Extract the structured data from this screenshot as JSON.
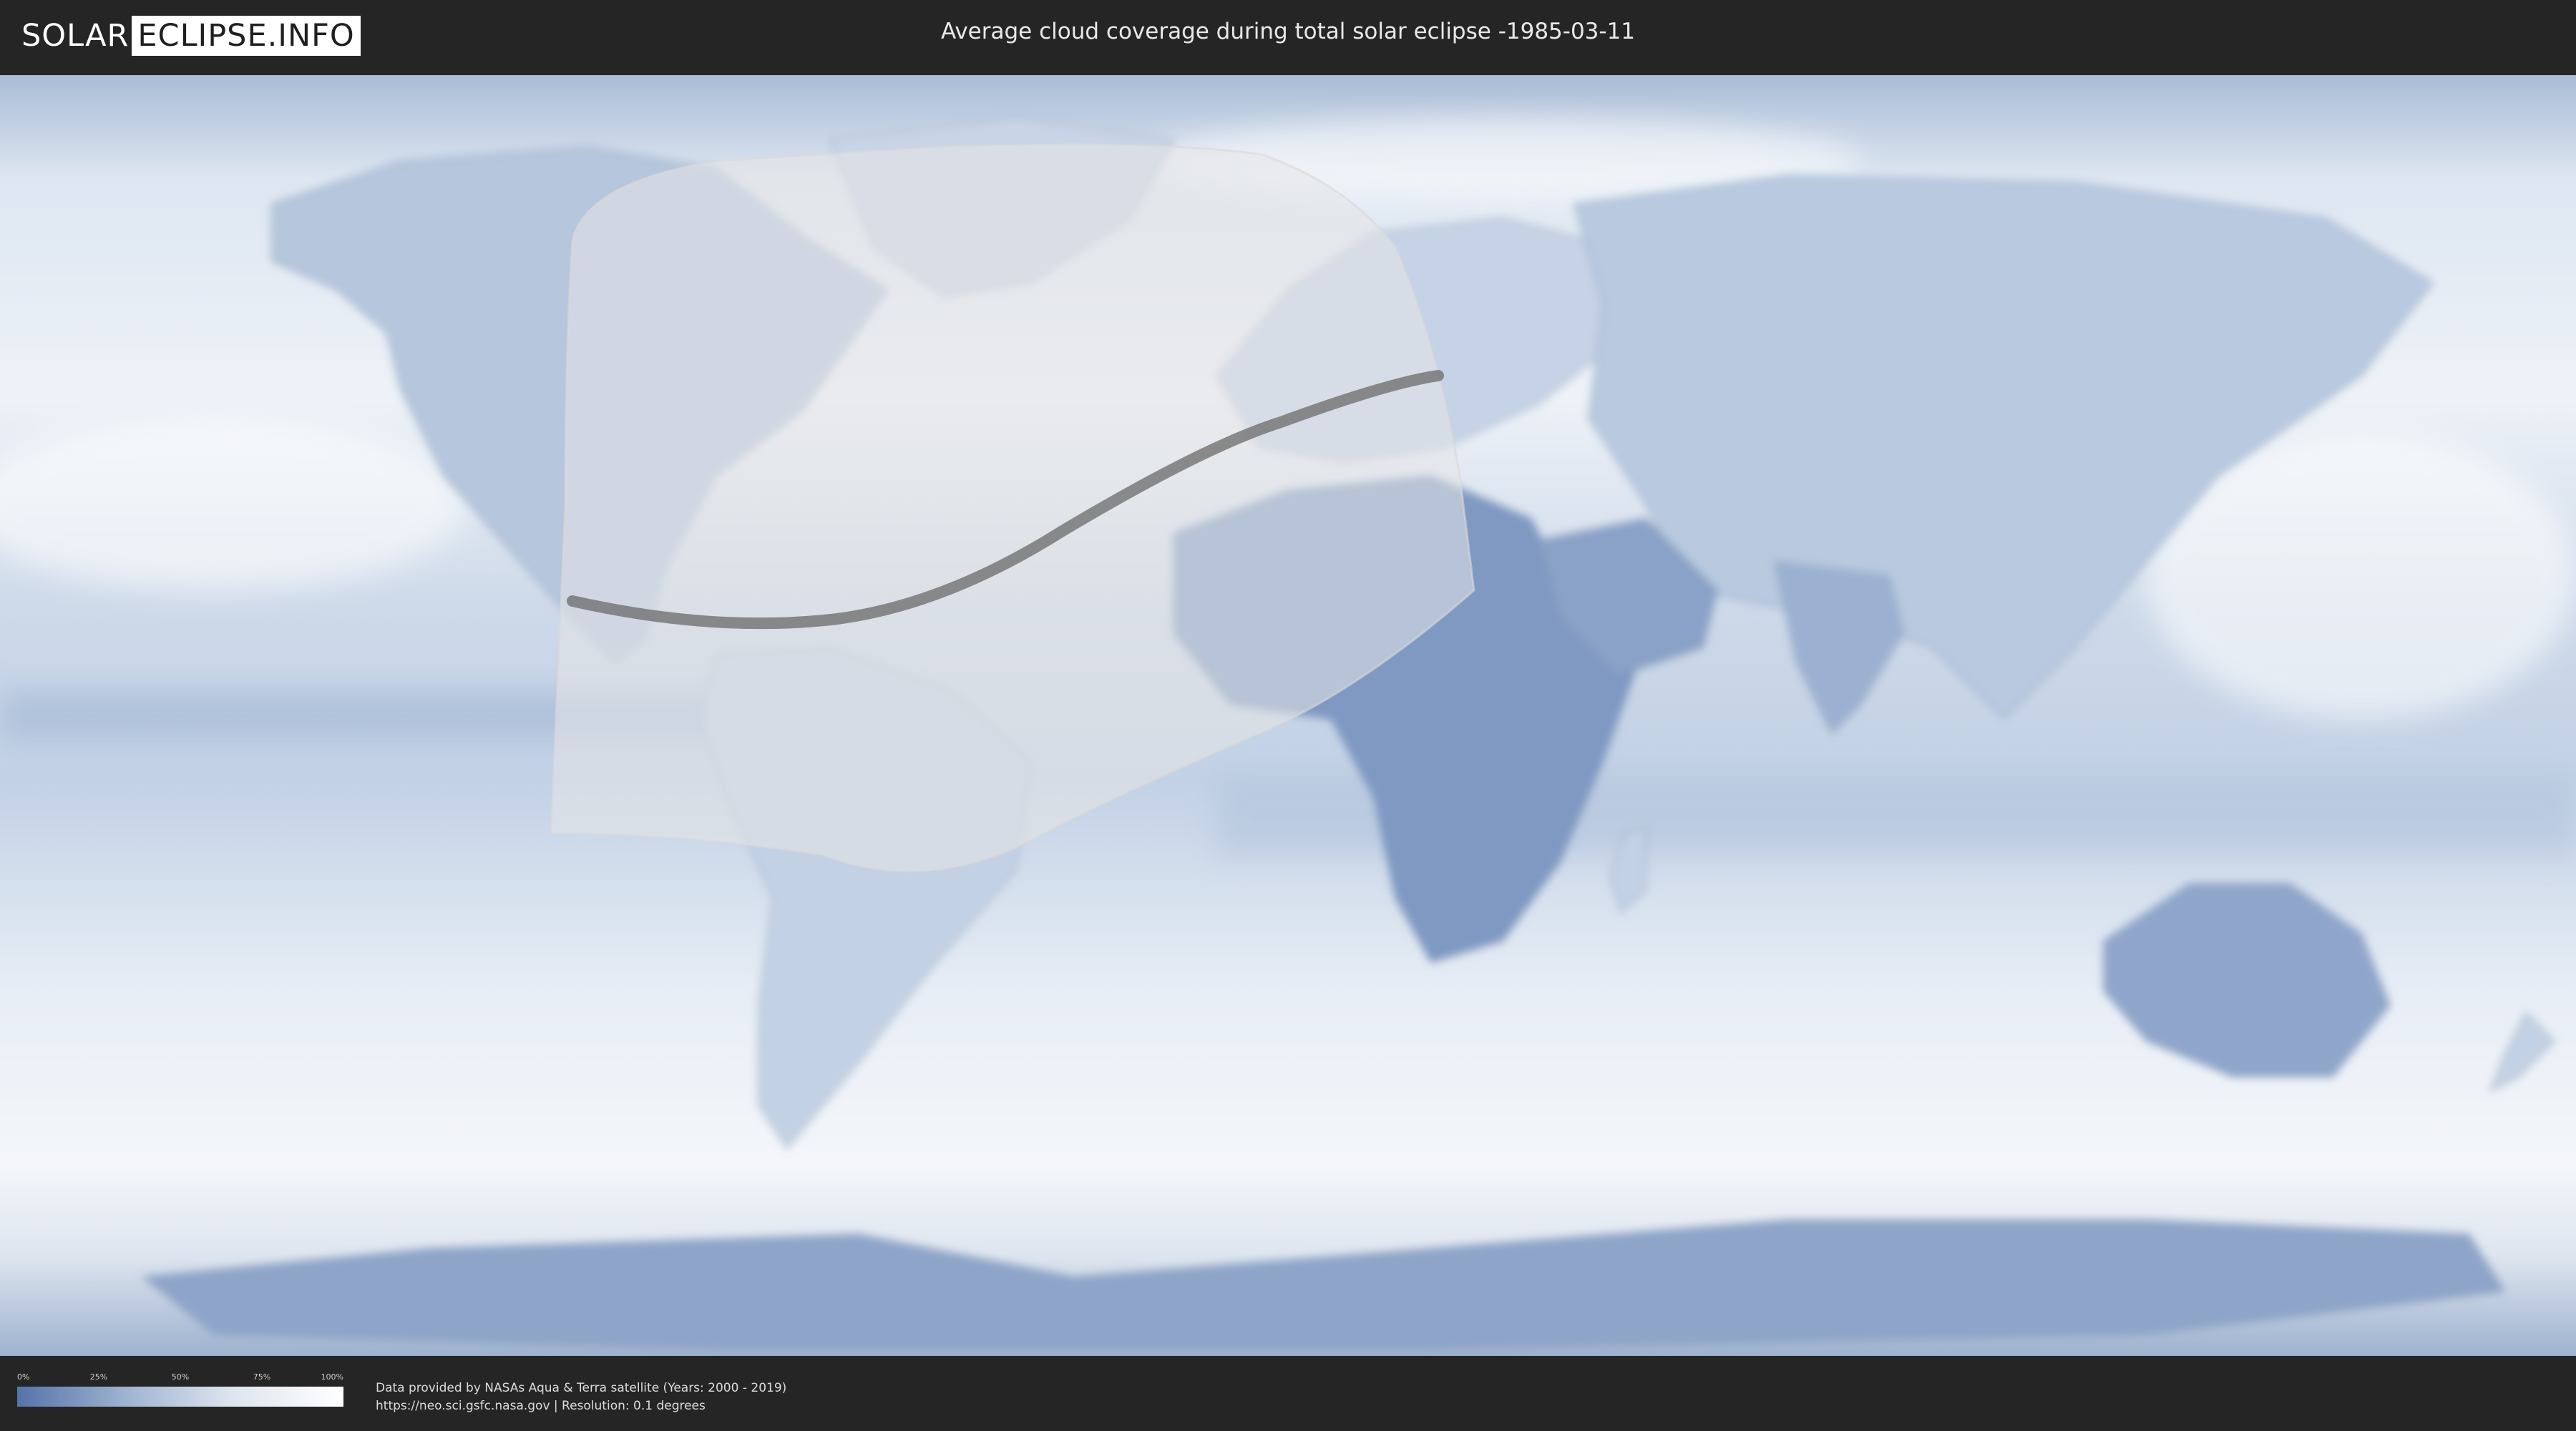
{
  "header": {
    "logo_left": "SOLAR",
    "logo_right": "ECLIPSE.INFO",
    "title": "Average cloud coverage during total solar eclipse -1985-03-11"
  },
  "map": {
    "projection": "equirectangular",
    "cloud_low_color": "#5673a8",
    "cloud_high_color": "#ffffff",
    "visibility_region_color": "#e6e6e6",
    "totality_path_color": "#6a6a6a"
  },
  "legend": {
    "ticks": [
      "0%",
      "25%",
      "50%",
      "75%",
      "100%"
    ]
  },
  "footer": {
    "line1": "Data provided by NASAs Aqua & Terra satellite (Years: 2000 - 2019)",
    "line2": "https://neo.sci.gsfc.nasa.gov | Resolution: 0.1 degrees"
  }
}
